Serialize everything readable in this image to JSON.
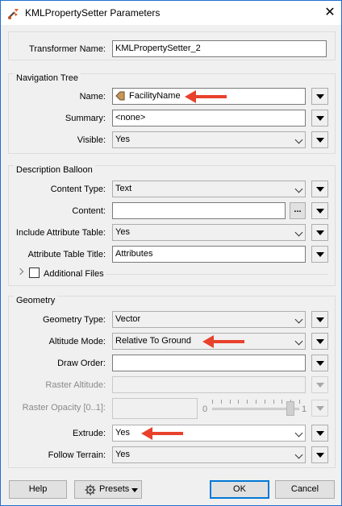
{
  "window": {
    "title": "KMLPropertySetter Parameters",
    "close_glyph": "✕"
  },
  "transformer": {
    "label": "Transformer Name:",
    "value": "KMLPropertySetter_2"
  },
  "navigation_tree": {
    "title": "Navigation Tree",
    "name_label": "Name:",
    "name_value": "FacilityName",
    "summary_label": "Summary:",
    "summary_value": "<none>",
    "visible_label": "Visible:",
    "visible_value": "Yes"
  },
  "description_balloon": {
    "title": "Description Balloon",
    "content_type_label": "Content Type:",
    "content_type_value": "Text",
    "content_label": "Content:",
    "content_value": "",
    "ellipsis": "...",
    "include_table_label": "Include Attribute Table:",
    "include_table_value": "Yes",
    "table_title_label": "Attribute Table Title:",
    "table_title_value": "Attributes",
    "additional_files_label": "Additional Files",
    "additional_files_checked": false
  },
  "geometry": {
    "title": "Geometry",
    "geometry_type_label": "Geometry Type:",
    "geometry_type_value": "Vector",
    "altitude_mode_label": "Altitude Mode:",
    "altitude_mode_value": "Relative To Ground",
    "draw_order_label": "Draw Order:",
    "draw_order_value": "",
    "raster_altitude_label": "Raster Altitude:",
    "raster_altitude_value": "",
    "raster_opacity_label": "Raster Opacity [0..1]:",
    "raster_opacity_value": "",
    "slider_min": "0",
    "slider_max": "1",
    "slider_level": 0.9,
    "extrude_label": "Extrude:",
    "extrude_value": "Yes",
    "follow_terrain_label": "Follow Terrain:",
    "follow_terrain_value": "Yes"
  },
  "footer": {
    "help": "Help",
    "presets": "Presets",
    "ok": "OK",
    "cancel": "Cancel"
  },
  "colors": {
    "annotation_arrow": "#e8412c",
    "attribute_icon": "#c8975a",
    "window_border": "#1f6fd0"
  }
}
